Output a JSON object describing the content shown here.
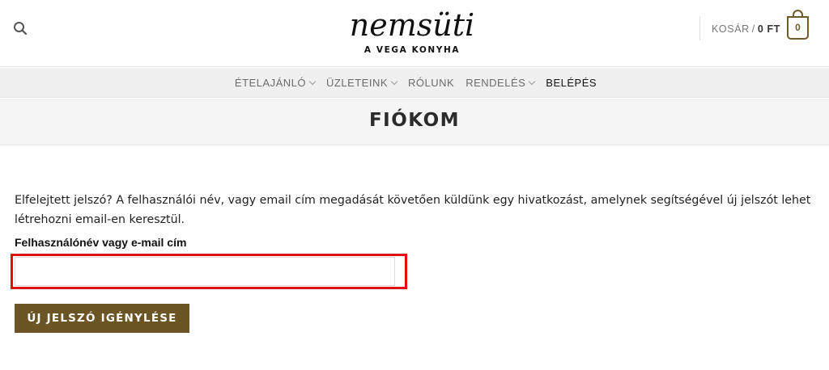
{
  "header": {
    "logo_script": "nemsüti",
    "logo_tagline": "A VEGA KONYHA",
    "search_icon": "search-icon",
    "cart": {
      "label": "KOSÁR",
      "separator": "/",
      "amount": "0 FT",
      "count": "0",
      "icon": "shopping-bag-icon"
    }
  },
  "nav": {
    "items": [
      {
        "label": "ÉTELAJÁNLÓ",
        "dropdown": true
      },
      {
        "label": "ÜZLETEINK",
        "dropdown": true
      },
      {
        "label": "RÓLUNK",
        "dropdown": false
      },
      {
        "label": "RENDELÉS",
        "dropdown": true
      },
      {
        "label": "BELÉPÉS",
        "dropdown": false
      }
    ]
  },
  "page": {
    "title": "FIÓKOM"
  },
  "form": {
    "intro_text": "Elfelejtett jelszó? A felhasználói név, vagy email cím megadását követően küldünk egy hivatkozást, amelynek segítségével új jelszót lehet létrehozni email-en keresztül.",
    "field_label": "Felhasználónév vagy e-mail cím",
    "field_value": "",
    "submit_label": "ÚJ JELSZÓ IGÉNYLÉSE"
  },
  "colors": {
    "brand": "#6b5524",
    "highlight": "#e01010"
  }
}
